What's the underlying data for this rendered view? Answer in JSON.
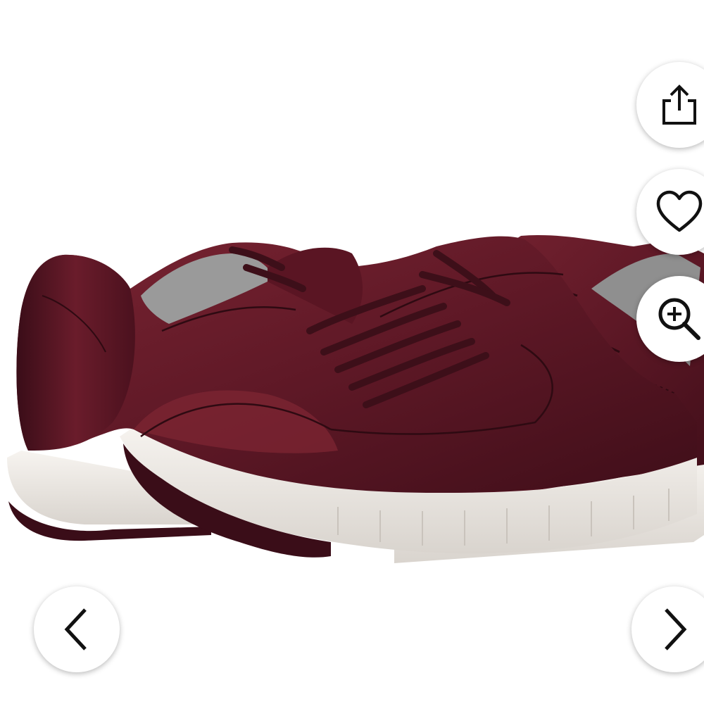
{
  "viewer": {
    "product_image": {
      "subject": "sneakers",
      "colors": {
        "leather": "#5a1523",
        "leather_highlight": "#7a2432",
        "sole": "#efebe6",
        "tread": "#3a0d18"
      }
    },
    "actions": {
      "share": {
        "icon": "share-icon"
      },
      "wishlist": {
        "icon": "heart-icon"
      },
      "zoom": {
        "icon": "zoom-in-icon"
      }
    },
    "navigation": {
      "previous": {
        "icon": "chevron-left-icon"
      },
      "next": {
        "icon": "chevron-right-icon"
      }
    }
  }
}
